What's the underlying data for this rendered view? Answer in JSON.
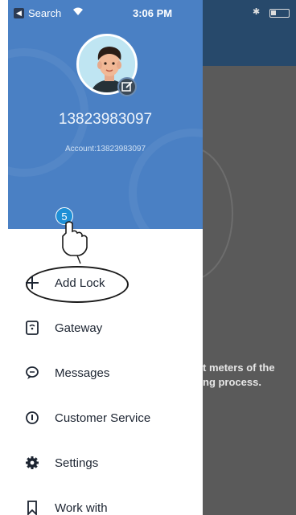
{
  "status_bar": {
    "carrier": "Search",
    "time": "3:06 PM"
  },
  "drawer": {
    "phone": "13823983097",
    "account": "Account:13823983097",
    "step_number": "5",
    "menu": [
      {
        "label": "Add Lock",
        "icon": "plus-icon"
      },
      {
        "label": "Gateway",
        "icon": "gateway-icon"
      },
      {
        "label": "Messages",
        "icon": "chat-bubble-icon"
      },
      {
        "label": "Customer Service",
        "icon": "info-icon"
      },
      {
        "label": "Settings",
        "icon": "gear-icon"
      },
      {
        "label": "Work with",
        "icon": "bookmark-icon"
      }
    ]
  },
  "background": {
    "text_line1": "t meters of the",
    "text_line2": "ng process."
  },
  "colors": {
    "drawer_header": "#4a80c4",
    "step_badge": "#1e8fd6",
    "overlay": "#5a5a5a"
  }
}
